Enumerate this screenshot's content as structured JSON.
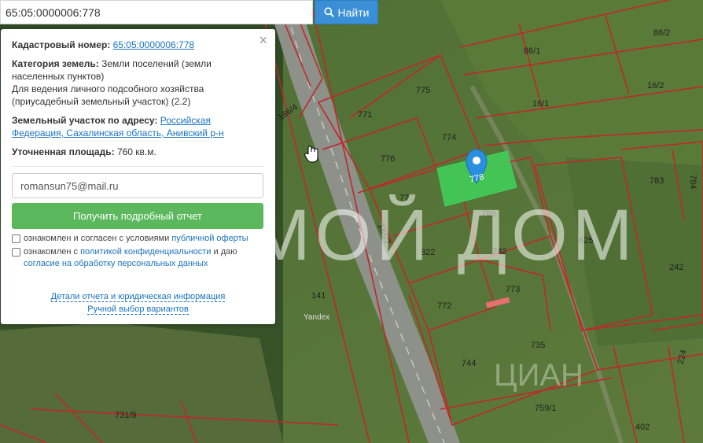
{
  "search": {
    "value": "65:05:0000006:778",
    "button_label": "Найти"
  },
  "panel": {
    "cadastral_label": "Кадастровый номер:",
    "cadastral_value": "65:05:0000006:778",
    "category_label": "Категория земель:",
    "category_value": "Земли поселений (земли населенных пунктов)",
    "usage_text": "Для ведения личного подсобного хозяйства (приусадебный земельный участок) (2.2)",
    "address_label": "Земельный участок по адресу:",
    "address_value": "Российская Федерация, Сахалинская область, Анивский р-н",
    "area_label": "Уточненная площадь:",
    "area_value": "760 кв.м.",
    "email_value": "romansun75@mail.ru",
    "report_button": "Получить подробный отчет",
    "consent1_prefix": "ознакомлен и согласен с условиями",
    "consent1_link": "публичной оферты",
    "consent2_prefix": "ознакомлен с",
    "consent2_link1": "политикой конфиденциальности",
    "consent2_mid": "и даю",
    "consent2_link2": "согласие на обработку персональных данных",
    "details_link": "Детали отчета и юридическая информация",
    "manual_link": "Ручной выбор вариантов"
  },
  "map": {
    "selected_plot": "778",
    "plots": [
      "86/1",
      "86/2",
      "16/2",
      "16/1",
      "775",
      "771",
      "774",
      "776",
      "777",
      "780",
      "782",
      "822",
      "773",
      "772",
      "735",
      "744",
      "783",
      "784",
      "625",
      "242",
      "141",
      "731/9",
      "759/1",
      "402",
      "224"
    ],
    "roads": [
      "186/4",
      "186/2"
    ],
    "provider": "Yandex",
    "watermark": "МОЙ ДОМ",
    "watermark2": "ЦИАН"
  },
  "colors": {
    "search_button": "#3a8fd6",
    "report_button": "#5cb85c",
    "selected_plot": "#3fd35a",
    "boundary": "#c0282a",
    "link": "#1a73c0"
  }
}
